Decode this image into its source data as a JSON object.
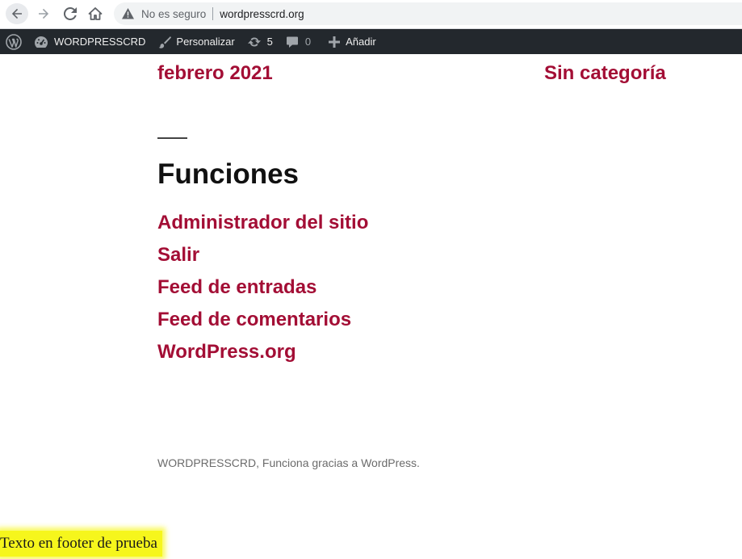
{
  "browser": {
    "security_label": "No es seguro",
    "url": "wordpresscrd.org"
  },
  "admin_bar": {
    "site_name": "WORDPRESSCRD",
    "customize": "Personalizar",
    "updates_count": "5",
    "comments_count": "0",
    "new_label": "Añadir"
  },
  "content": {
    "archive_link": "febrero 2021",
    "category_link": "Sin categoría",
    "meta_heading": "Funciones",
    "meta_links": [
      "Administrador del sitio",
      "Salir",
      "Feed de entradas",
      "Feed de comentarios",
      "WordPress.org"
    ]
  },
  "footer": {
    "credits": "WORDPRESSCRD, Funciona gracias a WordPress.",
    "test_text": "Texto en footer de prueba"
  },
  "colors": {
    "link": "#a30e35",
    "admin_bar": "#23282d",
    "highlight": "#f6f61c"
  }
}
